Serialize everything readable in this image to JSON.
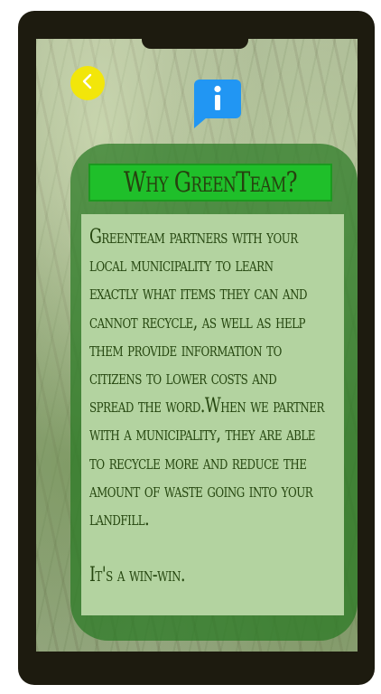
{
  "nav": {
    "back_icon": "chevron-left-icon",
    "back_color": "#f2e60a"
  },
  "header": {
    "icon": "info-icon",
    "icon_color": "#2196f3"
  },
  "card": {
    "title": "Why GreenTeam?",
    "paragraphs": [
      "Greenteam partners with your local municipality to learn exactly what items they can and cannot recycle, as well as help them provide information to citizens to lower costs and spread the word.When we partner with a municipality, they are able to recycle more and reduce the amount of waste going into your landfill.",
      "It's a win-win."
    ],
    "accent_color": "#1fbf2a",
    "text_color": "#25460f"
  }
}
